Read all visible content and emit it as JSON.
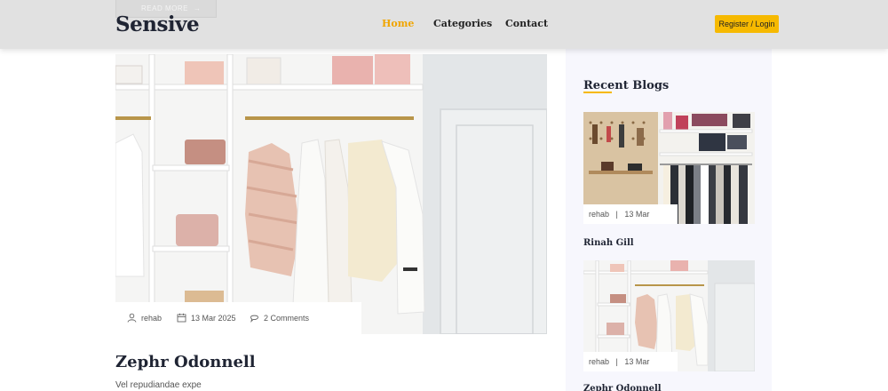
{
  "header": {
    "ghost_button": "READ MORE",
    "logo": "Sensive",
    "nav": [
      {
        "label": "Home",
        "active": true
      },
      {
        "label": "Categories",
        "active": false
      },
      {
        "label": "Contact",
        "active": false
      }
    ],
    "login_button": "Register / Login"
  },
  "post": {
    "author": "rehab",
    "date": "13 Mar 2025",
    "comments": "2 Comments",
    "title": "Zephr Odonnell",
    "excerpt": "Vel repudiandae expe"
  },
  "sidebar": {
    "title": "Recent Blogs",
    "items": [
      {
        "author": "rehab",
        "date": "13 Mar",
        "title": "Rinah Gill"
      },
      {
        "author": "rehab",
        "date": "13 Mar",
        "title": "Zephr Odonnell"
      }
    ]
  },
  "colors": {
    "accent": "#f6b900",
    "active_nav": "#f0a500",
    "header_bg": "#e1e1e1",
    "sidebar_bg": "#f7f7fd"
  }
}
